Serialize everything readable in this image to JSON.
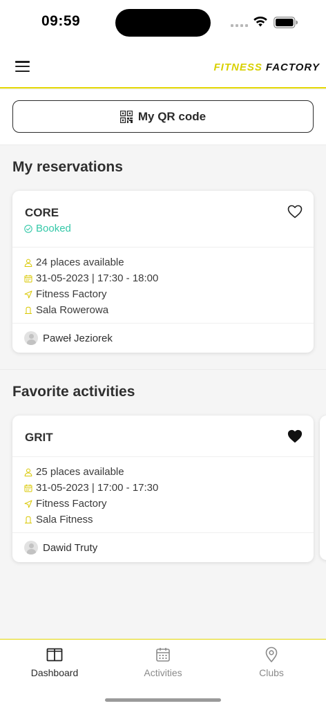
{
  "status_bar": {
    "time": "09:59"
  },
  "header": {
    "brand_part1": "FITNESS",
    "brand_part2": "FACTORY"
  },
  "qr_button": {
    "label": "My QR code"
  },
  "reservations": {
    "title": "My reservations",
    "card": {
      "title": "CORE",
      "status": "Booked",
      "places": "24 places available",
      "datetime": "31-05-2023 | 17:30 - 18:00",
      "club": "Fitness Factory",
      "room": "Sala Rowerowa",
      "trainer": "Paweł Jeziorek",
      "favorite": false
    }
  },
  "favorites": {
    "title": "Favorite activities",
    "card": {
      "title": "GRIT",
      "places": "25 places available",
      "datetime": "31-05-2023 | 17:00 - 17:30",
      "club": "Fitness Factory",
      "room": "Sala Fitness",
      "trainer": "Dawid Truty",
      "favorite": true
    }
  },
  "bottom_nav": {
    "items": [
      {
        "label": "Dashboard",
        "icon": "dashboard-icon",
        "active": true
      },
      {
        "label": "Activities",
        "icon": "calendar-icon",
        "active": false
      },
      {
        "label": "Clubs",
        "icon": "location-pin-icon",
        "active": false
      }
    ]
  },
  "colors": {
    "accent_yellow": "#e3d600",
    "booked_green": "#34c8a8",
    "icon_yellow": "#d9c700"
  }
}
